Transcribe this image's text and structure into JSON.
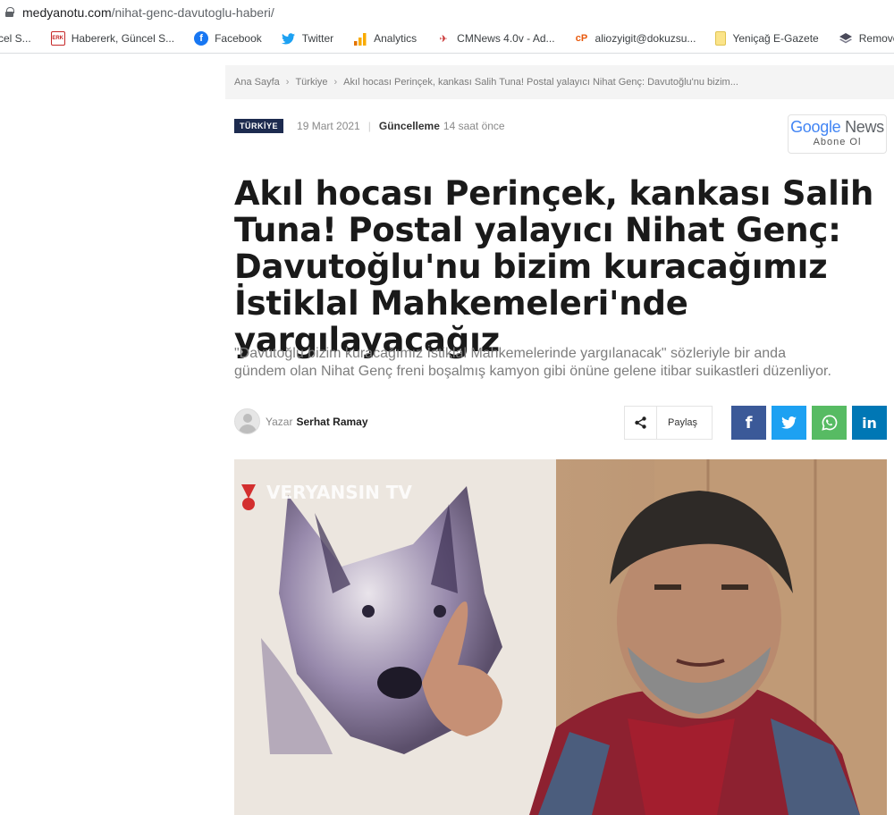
{
  "browser": {
    "url_domain": "medyanotu.com",
    "url_path": "/nihat-genc-davutoglu-haberi/",
    "bookmarks": [
      {
        "label": "cel S...",
        "icon": "page-icon"
      },
      {
        "label": "Habererk, Güncel S...",
        "icon": "erk-logo-icon"
      },
      {
        "label": "Facebook",
        "icon": "facebook-icon"
      },
      {
        "label": "Twitter",
        "icon": "twitter-icon"
      },
      {
        "label": "Analytics",
        "icon": "analytics-icon"
      },
      {
        "label": "CMNews 4.0v - Ad...",
        "icon": "cmnews-icon"
      },
      {
        "label": "aliozyigit@dokuzsu...",
        "icon": "cp-icon"
      },
      {
        "label": "Yeniçağ E-Gazete",
        "icon": "bookmark-folder-icon"
      },
      {
        "label": "Remove Backgroun",
        "icon": "layers-icon"
      }
    ]
  },
  "breadcrumb": {
    "home": "Ana Sayfa",
    "category": "Türkiye",
    "current": "Akıl hocası Perinçek, kankası Salih Tuna! Postal yalayıcı Nihat Genç: Davutoğlu'nu bizim..."
  },
  "meta": {
    "category_badge": "TÜRKİYE",
    "date": "19 Mart 2021",
    "updated_label": "Güncelleme",
    "updated_value": "14 saat önce"
  },
  "google_news": {
    "title_google": "Google",
    "title_news": "News",
    "subtitle": "Abone Ol"
  },
  "article": {
    "headline": "Akıl hocası Perinçek, kankası Salih Tuna! Postal yalayıcı Nihat Genç: Davutoğlu'nu bizim kuracağımız İstiklal Mahkemeleri'nde yargılayacağız",
    "summary": "\"Davutoğlu bizim kuracağımız İstiklal Mahkemelerinde yargılanacak\" sözleriyle bir anda gündem olan Nihat Genç freni boşalmış kamyon gibi önüne gelene itibar suikastleri düzenliyor.",
    "author_label": "Yazar",
    "author_name": "Serhat Ramay"
  },
  "share": {
    "label": "Paylaş",
    "networks": [
      "facebook",
      "twitter",
      "whatsapp",
      "linkedin"
    ]
  },
  "hero_image": {
    "watermark": "VERYANSIN TV"
  },
  "colors": {
    "badge_bg": "#1d2b4f",
    "facebook": "#3b5998",
    "twitter": "#1da1f2",
    "whatsapp": "#57bb63",
    "linkedin": "#0077b5"
  }
}
